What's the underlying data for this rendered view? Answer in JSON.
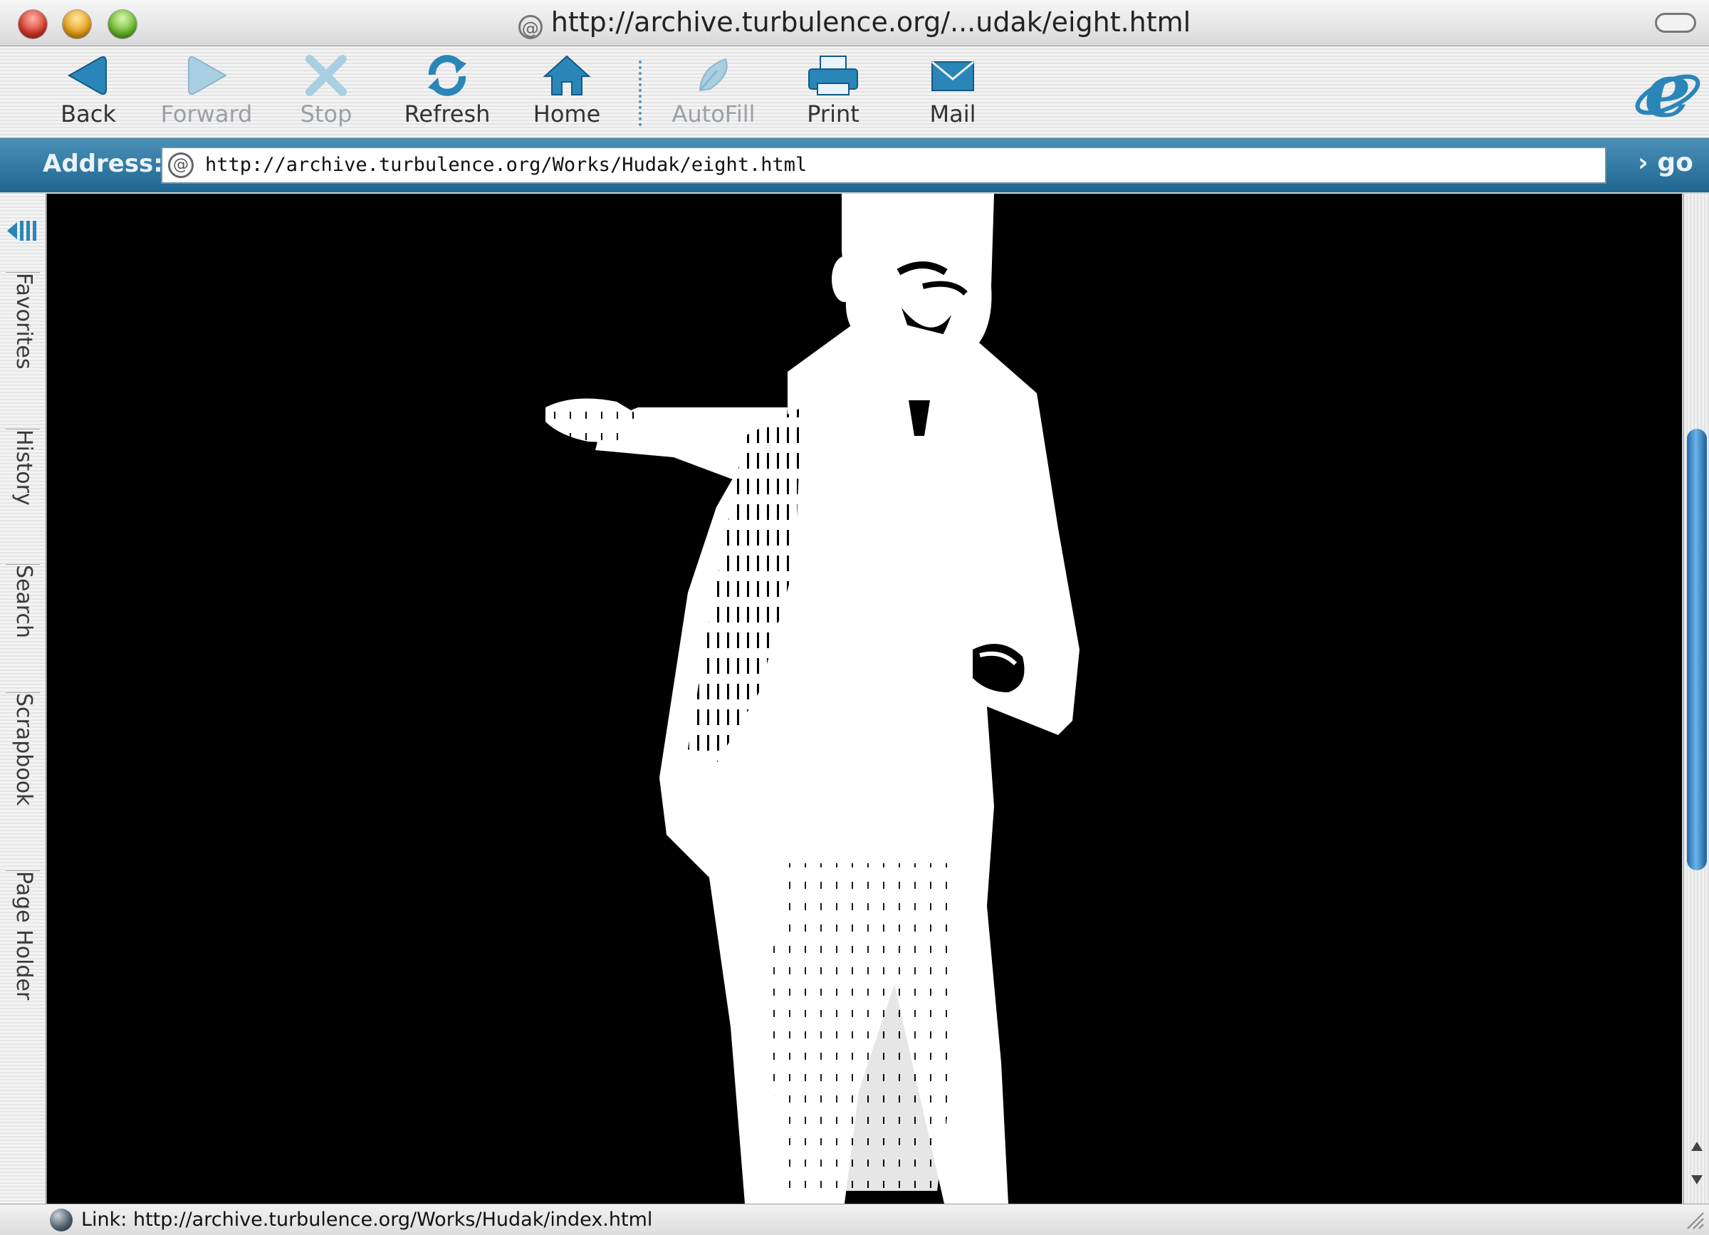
{
  "window": {
    "title": "http://archive.turbulence.org/...udak/eight.html"
  },
  "toolbar": {
    "buttons": [
      {
        "label": "Back",
        "icon": "back-arrow-icon",
        "enabled": true
      },
      {
        "label": "Forward",
        "icon": "forward-arrow-icon",
        "enabled": false
      },
      {
        "label": "Stop",
        "icon": "stop-x-icon",
        "enabled": false
      },
      {
        "label": "Refresh",
        "icon": "refresh-icon",
        "enabled": true
      },
      {
        "label": "Home",
        "icon": "home-icon",
        "enabled": true
      },
      {
        "label": "AutoFill",
        "icon": "autofill-icon",
        "enabled": false
      },
      {
        "label": "Print",
        "icon": "print-icon",
        "enabled": true
      },
      {
        "label": "Mail",
        "icon": "mail-icon",
        "enabled": true
      }
    ],
    "brand_icon": "internet-explorer-e-logo"
  },
  "address": {
    "label": "Address:",
    "url": "http://archive.turbulence.org/Works/Hudak/eight.html",
    "go_label": "› go"
  },
  "explorer_bar": {
    "tabs": [
      "Favorites",
      "History",
      "Search",
      "Scrapbook",
      "Page Holder"
    ]
  },
  "content": {
    "image_description_icon": "figure-silhouette-image",
    "background": "#000000"
  },
  "status": {
    "text": "Link: http://archive.turbulence.org/Works/Hudak/index.html"
  },
  "colors": {
    "accent": "#1f6792",
    "icon_blue": "#2a7fb0",
    "disabled": "#9aa0a6"
  }
}
